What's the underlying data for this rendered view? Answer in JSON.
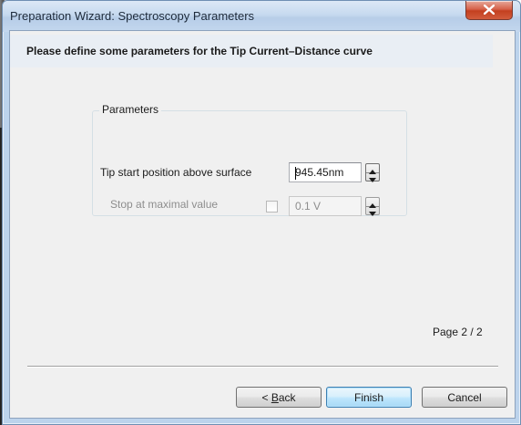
{
  "window": {
    "title": "Preparation Wizard: Spectroscopy Parameters"
  },
  "header": {
    "text": "Please define some parameters for the Tip Current–Distance curve"
  },
  "parameters": {
    "group_label": "Parameters",
    "tip_start": {
      "label": "Tip start position above surface",
      "value": "945.45nm"
    },
    "stop_max": {
      "label": "Stop at maximal value",
      "value": "0.1 V",
      "checked": false,
      "enabled": false
    }
  },
  "footer": {
    "page_indicator": "Page 2 / 2",
    "back_prefix": "< ",
    "back_accel": "B",
    "back_rest": "ack",
    "finish_label": "Finish",
    "cancel_label": "Cancel"
  },
  "colors": {
    "header_band": "#e9eef4",
    "dialog_bg": "#f0f0f0",
    "close_button": "#c3401f",
    "default_button_border": "#3c7fb1"
  },
  "icons": {
    "close": "close-x-icon",
    "spin_up": "triangle-up-icon",
    "spin_down": "triangle-down-icon"
  }
}
